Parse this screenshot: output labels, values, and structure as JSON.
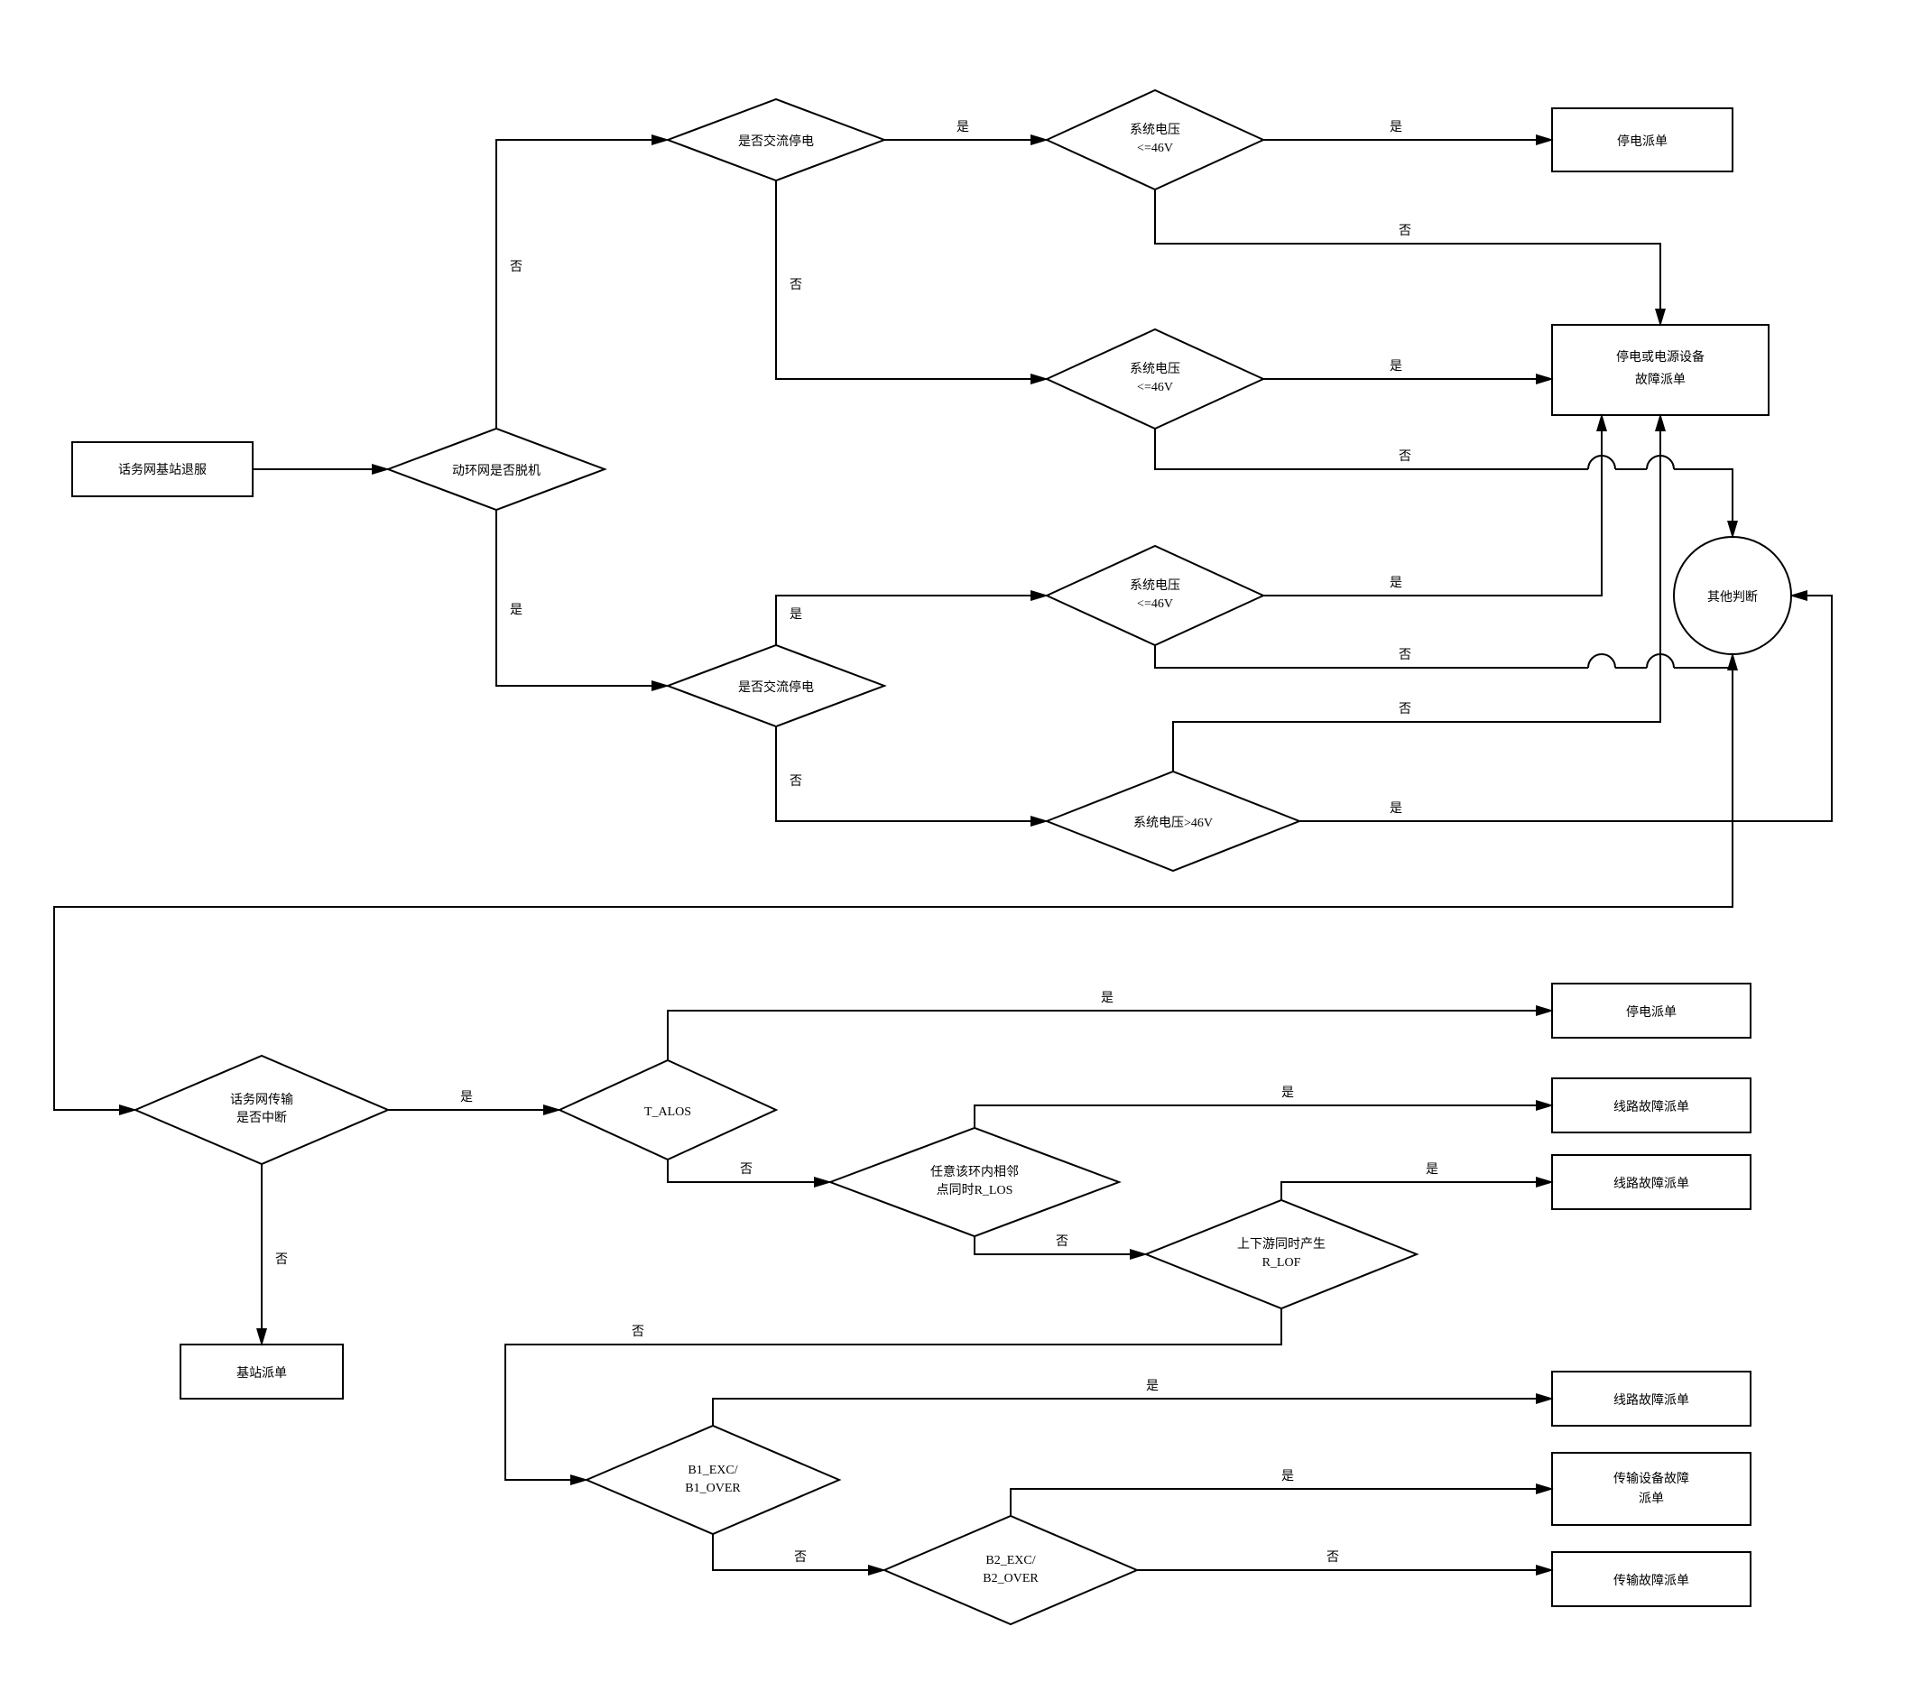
{
  "start": "话务网基站退服",
  "decisions": {
    "d1": "动环网是否脱机",
    "d2a": "是否交流停电",
    "d2b": "是否交流停电",
    "d3a": "系统电压\n<=46V",
    "d3b": "系统电压\n<=46V",
    "d3c": "系统电压\n<=46V",
    "d3d": "系统电压>46V",
    "d4": "话务网传输\n是否中断",
    "d5": "T_ALOS",
    "d6": "任意该环内相邻\n点同时R_LOS",
    "d7": "上下游同时产生\nR_LOF",
    "d8": "B1_EXC/\nB1_OVER",
    "d9": "B2_EXC/\nB2_OVER"
  },
  "outcomes": {
    "o1": "停电派单",
    "o2": "停电或电源设备\n故障派单",
    "o3": "其他判断",
    "o4": "停电派单",
    "o5": "线路故障派单",
    "o6": "线路故障派单",
    "o7": "基站派单",
    "o8": "线路故障派单",
    "o9": "传输设备故障\n派单",
    "o10": "传输故障派单"
  },
  "labels": {
    "yes": "是",
    "no": "否"
  }
}
